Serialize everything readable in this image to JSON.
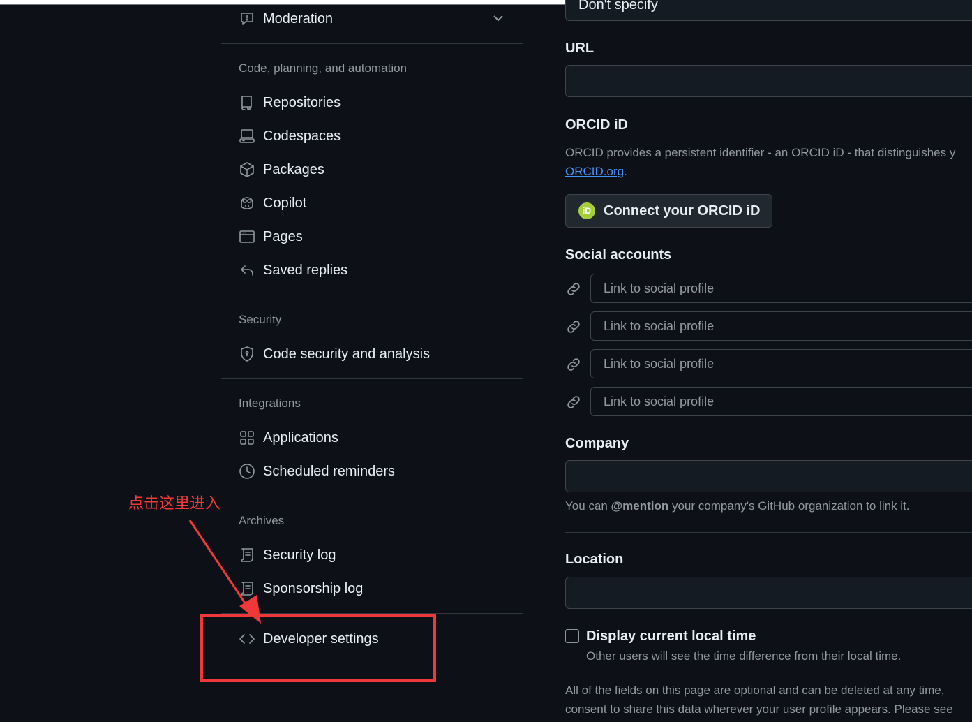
{
  "sidebar": {
    "moderation": "Moderation",
    "groups": {
      "code": "Code, planning, and automation",
      "security": "Security",
      "integrations": "Integrations",
      "archives": "Archives"
    },
    "items": {
      "repositories": "Repositories",
      "codespaces": "Codespaces",
      "packages": "Packages",
      "copilot": "Copilot",
      "pages": "Pages",
      "saved_replies": "Saved replies",
      "code_security": "Code security and analysis",
      "applications": "Applications",
      "scheduled_reminders": "Scheduled reminders",
      "security_log": "Security log",
      "sponsorship_log": "Sponsorship log",
      "developer_settings": "Developer settings"
    }
  },
  "main": {
    "pronouns_value": "Don't specify",
    "url_label": "URL",
    "orcid_label": "ORCID iD",
    "orcid_desc": "ORCID provides a persistent identifier - an ORCID iD - that distinguishes y",
    "orcid_link": "ORCID.org",
    "orcid_period": ".",
    "orcid_badge": "iD",
    "orcid_button": "Connect your ORCID iD",
    "social_label": "Social accounts",
    "social_placeholder": "Link to social profile",
    "company_label": "Company",
    "company_hint_pre": "You can ",
    "company_hint_bold": "@mention",
    "company_hint_post": " your company's GitHub organization to link it.",
    "location_label": "Location",
    "local_time_label": "Display current local time",
    "local_time_desc": "Other users will see the time difference from their local time.",
    "footer_line1": "All of the fields on this page are optional and can be deleted at any time,",
    "footer_line2": "consent to share this data wherever your user profile appears. Please see"
  },
  "annotation": {
    "text": "点击这里进入",
    "color": "#f0383a"
  }
}
